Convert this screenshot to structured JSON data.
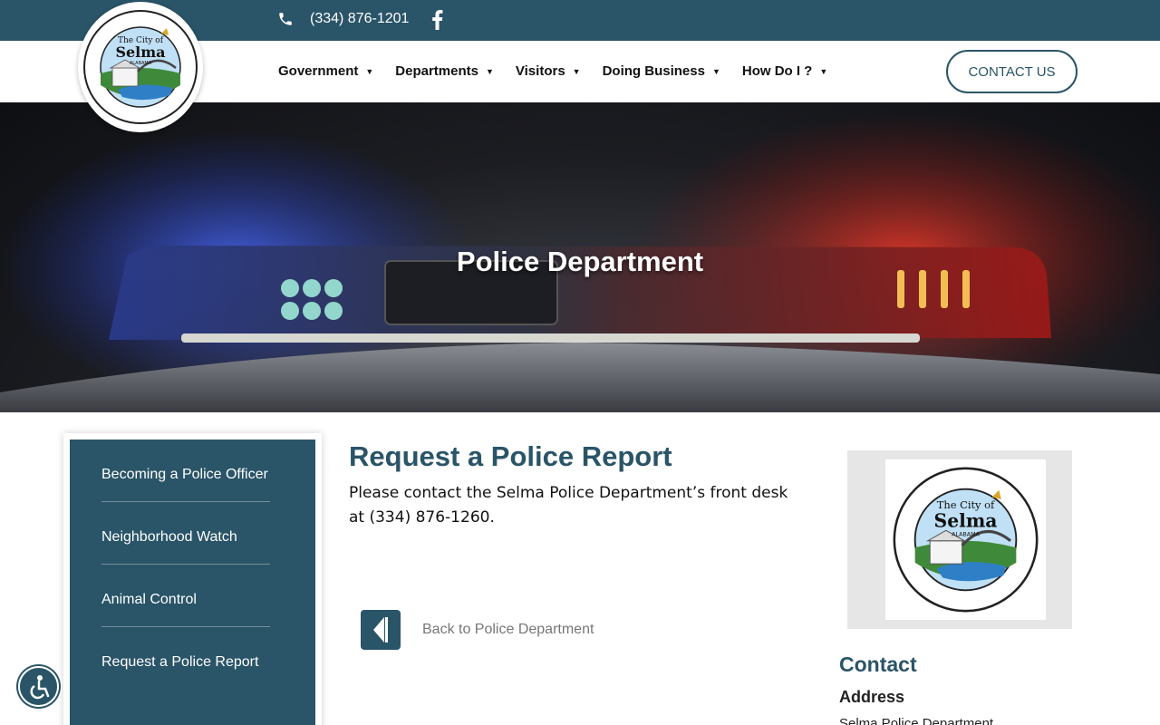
{
  "topbar": {
    "phone": "(334) 876-1201",
    "phone_icon": "phone-icon",
    "social_icon": "facebook-icon"
  },
  "logo": {
    "line1": "The City of",
    "line2": "Selma",
    "line3": "ALABAMA",
    "motto": "Civil War to Civil Rights and Beyond"
  },
  "nav": {
    "items": [
      {
        "label": "Government"
      },
      {
        "label": "Departments"
      },
      {
        "label": "Visitors"
      },
      {
        "label": "Doing Business"
      },
      {
        "label": "How Do I ?"
      }
    ],
    "contact_label": "CONTACT US"
  },
  "hero": {
    "title": "Police Department"
  },
  "sidebar": {
    "items": [
      {
        "label": "Becoming a Police Officer"
      },
      {
        "label": "Neighborhood Watch"
      },
      {
        "label": "Animal Control"
      },
      {
        "label": "Request a Police Report"
      }
    ]
  },
  "main": {
    "title": "Request a Police Report",
    "text": "Please contact the Selma Police Department’s front desk at (334) 876-1260.",
    "back_label": "Back to Police Department"
  },
  "right": {
    "contact_heading": "Contact",
    "address_heading": "Address",
    "address_line": "Selma Police Department"
  },
  "colors": {
    "brand": "#2a5468",
    "text": "#111111",
    "muted": "#777777"
  }
}
